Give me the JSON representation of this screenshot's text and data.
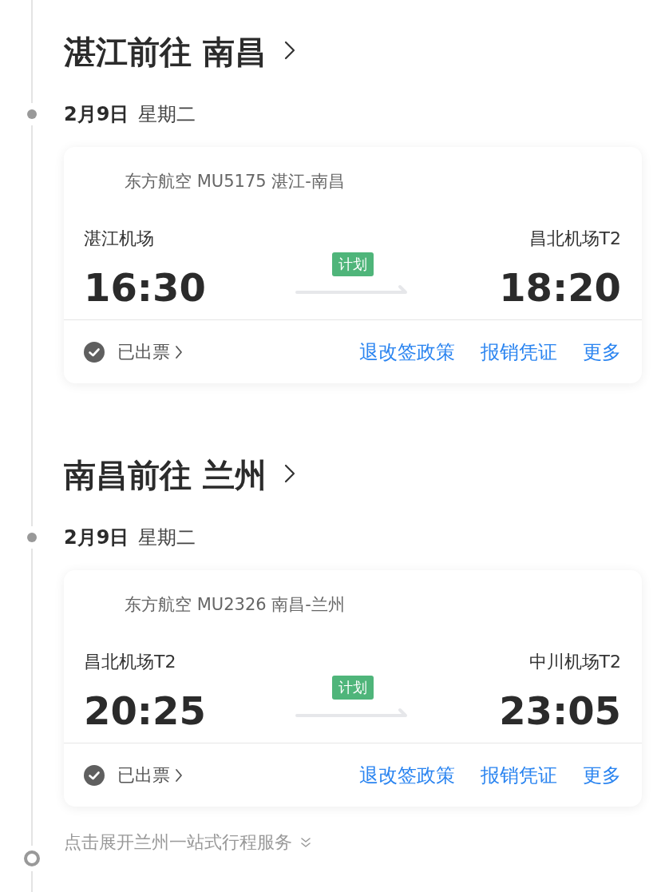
{
  "trips": [
    {
      "title": "湛江前往 南昌",
      "date": "2月9日",
      "weekday": "星期二",
      "flight": {
        "airline_info": "东方航空 MU5175 湛江-南昌",
        "departure_airport": "湛江机场",
        "departure_time": "16:30",
        "status": "计划",
        "arrival_airport": "昌北机场T2",
        "arrival_time": "18:20",
        "ticket_status": "已出票",
        "actions": [
          "退改签政策",
          "报销凭证",
          "更多"
        ]
      }
    },
    {
      "title": "南昌前往 兰州",
      "date": "2月9日",
      "weekday": "星期二",
      "flight": {
        "airline_info": "东方航空 MU2326 南昌-兰州",
        "departure_airport": "昌北机场T2",
        "departure_time": "20:25",
        "status": "计划",
        "arrival_airport": "中川机场T2",
        "arrival_time": "23:05",
        "ticket_status": "已出票",
        "actions": [
          "退改签政策",
          "报销凭证",
          "更多"
        ]
      }
    }
  ],
  "expand_link": "点击展开兰州一站式行程服务"
}
